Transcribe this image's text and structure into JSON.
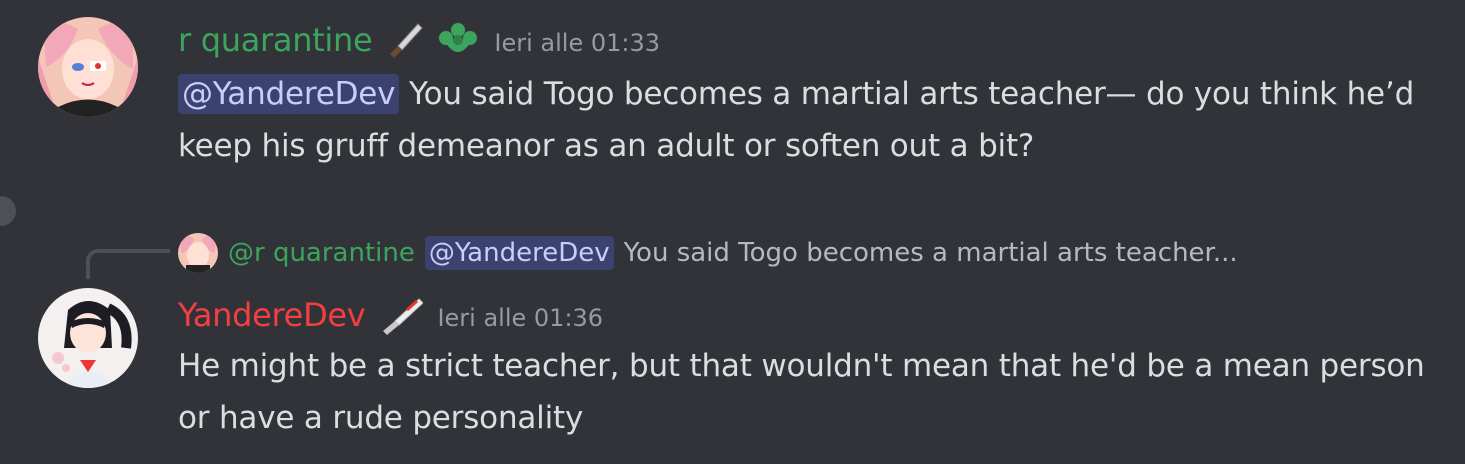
{
  "messages": [
    {
      "author": "r quarantine",
      "author_color": "#3ba55d",
      "role_icons": [
        "knife-icon",
        "green-heart-flower-icon"
      ],
      "timestamp": "Ieri alle 01:33",
      "mention": "@YandereDev",
      "text": "You said Togo becomes a martial arts teacher— do you think he’d keep his gruff demeanor as an adult or soften out a bit?"
    },
    {
      "reply": {
        "author": "@r quarantine",
        "mention": "@YandereDev",
        "excerpt": "You said Togo becomes a martial arts teacher..."
      },
      "author": "YandereDev",
      "author_color": "#f23f42",
      "role_icons": [
        "red-knife-icon"
      ],
      "timestamp": "Ieri alle 01:36",
      "text": "He might be a strict teacher, but that wouldn't mean that he'd be a mean person or have a rude personality"
    }
  ],
  "colors": {
    "background": "#313338",
    "text": "#dbdee1",
    "muted": "#949ba4",
    "mention_bg": "#3c4270",
    "mention_text": "#c9cdfb"
  }
}
